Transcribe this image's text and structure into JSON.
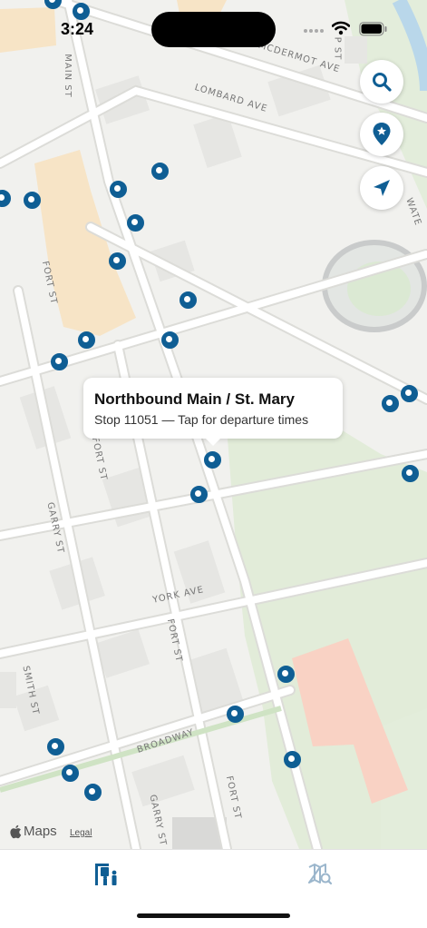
{
  "status_bar": {
    "time": "3:24"
  },
  "map": {
    "street_labels": {
      "main_st": "MAIN ST",
      "mcdermot_ave": "MCDERMOT AVE",
      "lombard_ave": "LOMBARD AVE",
      "fort_st_upper": "FORT ST",
      "fort_st_middle": "FORT ST",
      "fort_st_lower": "FORT ST",
      "garry_st_upper": "GARRY ST",
      "garry_st_lower": "GARRY ST",
      "york_ave": "YORK AVE",
      "smith_st": "SMITH ST",
      "broadway": "BROADWAY",
      "water_partial": "WATE",
      "top_partial": "P ST"
    },
    "callout": {
      "title": "Northbound Main / St. Mary",
      "subtitle": "Stop 11051  —  Tap for departure times"
    },
    "attribution": {
      "logo_text": "Maps",
      "legal": "Legal"
    }
  },
  "colors": {
    "accent": "#0f5e94",
    "stop_marker": "#0f5e94",
    "tab_active": "#0f5e94",
    "tab_inactive": "#9bb6cc"
  },
  "tabs": [
    {
      "name": "stops",
      "icon": "bus-stop-icon",
      "active": true
    },
    {
      "name": "map-search",
      "icon": "map-search-icon",
      "active": false
    }
  ]
}
